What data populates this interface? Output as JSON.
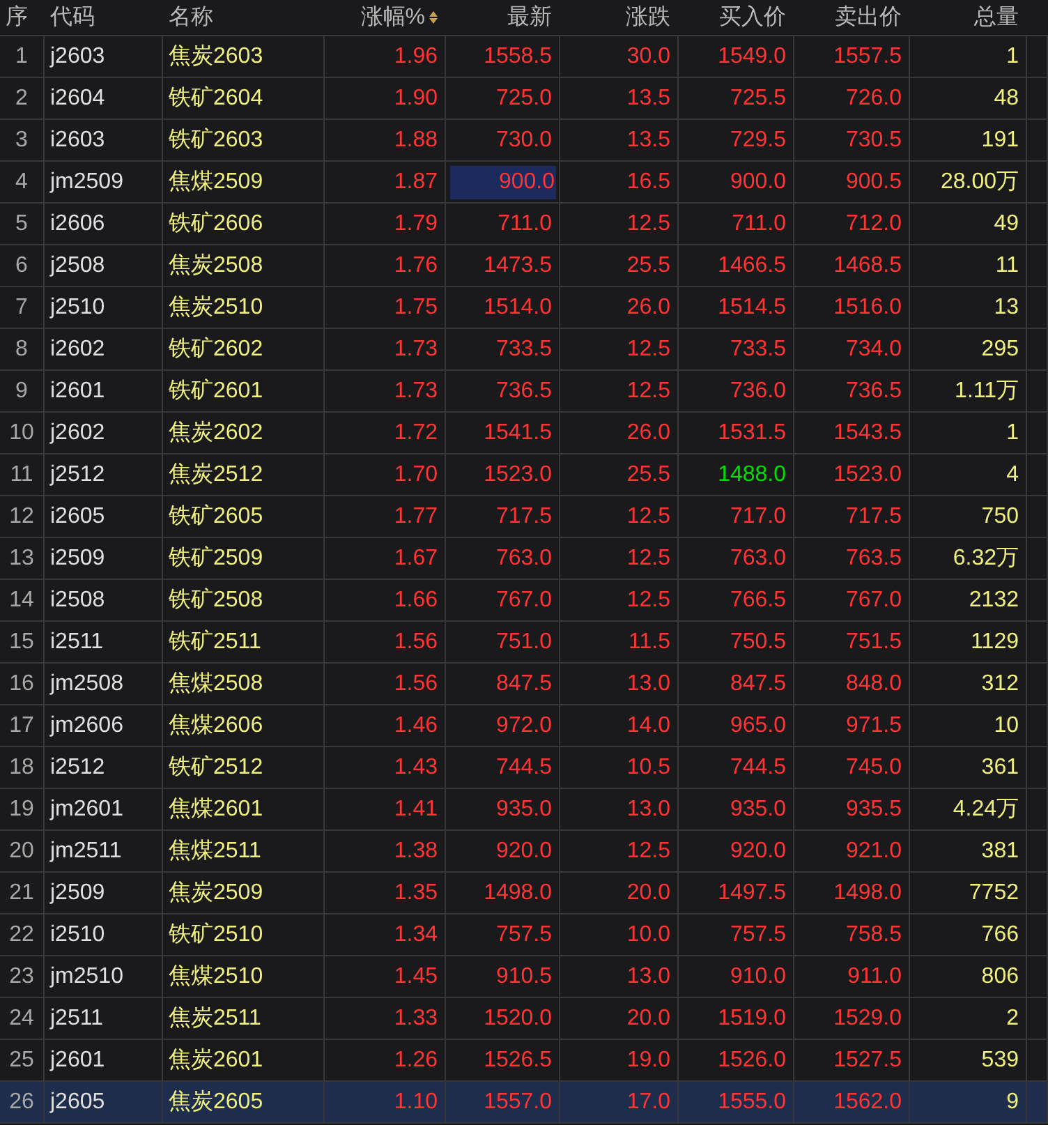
{
  "columns": [
    {
      "label": "序",
      "sorted": false
    },
    {
      "label": "代码",
      "sorted": false
    },
    {
      "label": "名称",
      "sorted": false
    },
    {
      "label": "涨幅%",
      "sorted": true
    },
    {
      "label": "最新",
      "sorted": false
    },
    {
      "label": "涨跌",
      "sorted": false
    },
    {
      "label": "买入价",
      "sorted": false
    },
    {
      "label": "卖出价",
      "sorted": false
    },
    {
      "label": "总量",
      "sorted": false
    }
  ],
  "rows": [
    {
      "cells": [
        "1",
        "j2603",
        "焦炭2603",
        "1.96",
        "1558.5",
        "30.0",
        "1549.0",
        "1557.5",
        "1"
      ],
      "bid_falling": false,
      "latest_highlighted": false,
      "selected": false
    },
    {
      "cells": [
        "2",
        "i2604",
        "铁矿2604",
        "1.90",
        "725.0",
        "13.5",
        "725.5",
        "726.0",
        "48"
      ],
      "bid_falling": false,
      "latest_highlighted": false,
      "selected": false
    },
    {
      "cells": [
        "3",
        "i2603",
        "铁矿2603",
        "1.88",
        "730.0",
        "13.5",
        "729.5",
        "730.5",
        "191"
      ],
      "bid_falling": false,
      "latest_highlighted": false,
      "selected": false
    },
    {
      "cells": [
        "4",
        "jm2509",
        "焦煤2509",
        "1.87",
        "900.0",
        "16.5",
        "900.0",
        "900.5",
        "28.00万"
      ],
      "bid_falling": false,
      "latest_highlighted": true,
      "selected": false
    },
    {
      "cells": [
        "5",
        "i2606",
        "铁矿2606",
        "1.79",
        "711.0",
        "12.5",
        "711.0",
        "712.0",
        "49"
      ],
      "bid_falling": false,
      "latest_highlighted": false,
      "selected": false
    },
    {
      "cells": [
        "6",
        "j2508",
        "焦炭2508",
        "1.76",
        "1473.5",
        "25.5",
        "1466.5",
        "1468.5",
        "11"
      ],
      "bid_falling": false,
      "latest_highlighted": false,
      "selected": false
    },
    {
      "cells": [
        "7",
        "j2510",
        "焦炭2510",
        "1.75",
        "1514.0",
        "26.0",
        "1514.5",
        "1516.0",
        "13"
      ],
      "bid_falling": false,
      "latest_highlighted": false,
      "selected": false
    },
    {
      "cells": [
        "8",
        "i2602",
        "铁矿2602",
        "1.73",
        "733.5",
        "12.5",
        "733.5",
        "734.0",
        "295"
      ],
      "bid_falling": false,
      "latest_highlighted": false,
      "selected": false
    },
    {
      "cells": [
        "9",
        "i2601",
        "铁矿2601",
        "1.73",
        "736.5",
        "12.5",
        "736.0",
        "736.5",
        "1.11万"
      ],
      "bid_falling": false,
      "latest_highlighted": false,
      "selected": false
    },
    {
      "cells": [
        "10",
        "j2602",
        "焦炭2602",
        "1.72",
        "1541.5",
        "26.0",
        "1531.5",
        "1543.5",
        "1"
      ],
      "bid_falling": false,
      "latest_highlighted": false,
      "selected": false
    },
    {
      "cells": [
        "11",
        "j2512",
        "焦炭2512",
        "1.70",
        "1523.0",
        "25.5",
        "1488.0",
        "1523.0",
        "4"
      ],
      "bid_falling": true,
      "latest_highlighted": false,
      "selected": false
    },
    {
      "cells": [
        "12",
        "i2605",
        "铁矿2605",
        "1.77",
        "717.5",
        "12.5",
        "717.0",
        "717.5",
        "750"
      ],
      "bid_falling": false,
      "latest_highlighted": false,
      "selected": false
    },
    {
      "cells": [
        "13",
        "i2509",
        "铁矿2509",
        "1.67",
        "763.0",
        "12.5",
        "763.0",
        "763.5",
        "6.32万"
      ],
      "bid_falling": false,
      "latest_highlighted": false,
      "selected": false
    },
    {
      "cells": [
        "14",
        "i2508",
        "铁矿2508",
        "1.66",
        "767.0",
        "12.5",
        "766.5",
        "767.0",
        "2132"
      ],
      "bid_falling": false,
      "latest_highlighted": false,
      "selected": false
    },
    {
      "cells": [
        "15",
        "i2511",
        "铁矿2511",
        "1.56",
        "751.0",
        "11.5",
        "750.5",
        "751.5",
        "1129"
      ],
      "bid_falling": false,
      "latest_highlighted": false,
      "selected": false
    },
    {
      "cells": [
        "16",
        "jm2508",
        "焦煤2508",
        "1.56",
        "847.5",
        "13.0",
        "847.5",
        "848.0",
        "312"
      ],
      "bid_falling": false,
      "latest_highlighted": false,
      "selected": false
    },
    {
      "cells": [
        "17",
        "jm2606",
        "焦煤2606",
        "1.46",
        "972.0",
        "14.0",
        "965.0",
        "971.5",
        "10"
      ],
      "bid_falling": false,
      "latest_highlighted": false,
      "selected": false
    },
    {
      "cells": [
        "18",
        "i2512",
        "铁矿2512",
        "1.43",
        "744.5",
        "10.5",
        "744.5",
        "745.0",
        "361"
      ],
      "bid_falling": false,
      "latest_highlighted": false,
      "selected": false
    },
    {
      "cells": [
        "19",
        "jm2601",
        "焦煤2601",
        "1.41",
        "935.0",
        "13.0",
        "935.0",
        "935.5",
        "4.24万"
      ],
      "bid_falling": false,
      "latest_highlighted": false,
      "selected": false
    },
    {
      "cells": [
        "20",
        "jm2511",
        "焦煤2511",
        "1.38",
        "920.0",
        "12.5",
        "920.0",
        "921.0",
        "381"
      ],
      "bid_falling": false,
      "latest_highlighted": false,
      "selected": false
    },
    {
      "cells": [
        "21",
        "j2509",
        "焦炭2509",
        "1.35",
        "1498.0",
        "20.0",
        "1497.5",
        "1498.0",
        "7752"
      ],
      "bid_falling": false,
      "latest_highlighted": false,
      "selected": false
    },
    {
      "cells": [
        "22",
        "i2510",
        "铁矿2510",
        "1.34",
        "757.5",
        "10.0",
        "757.5",
        "758.5",
        "766"
      ],
      "bid_falling": false,
      "latest_highlighted": false,
      "selected": false
    },
    {
      "cells": [
        "23",
        "jm2510",
        "焦煤2510",
        "1.45",
        "910.5",
        "13.0",
        "910.0",
        "911.0",
        "806"
      ],
      "bid_falling": false,
      "latest_highlighted": false,
      "selected": false
    },
    {
      "cells": [
        "24",
        "j2511",
        "焦炭2511",
        "1.33",
        "1520.0",
        "20.0",
        "1519.0",
        "1529.0",
        "2"
      ],
      "bid_falling": false,
      "latest_highlighted": false,
      "selected": false
    },
    {
      "cells": [
        "25",
        "j2601",
        "焦炭2601",
        "1.26",
        "1526.5",
        "19.0",
        "1526.0",
        "1527.5",
        "539"
      ],
      "bid_falling": false,
      "latest_highlighted": false,
      "selected": false
    },
    {
      "cells": [
        "26",
        "j2605",
        "焦炭2605",
        "1.10",
        "1557.0",
        "17.0",
        "1555.0",
        "1562.0",
        "9"
      ],
      "bid_falling": false,
      "latest_highlighted": false,
      "selected": true
    }
  ]
}
